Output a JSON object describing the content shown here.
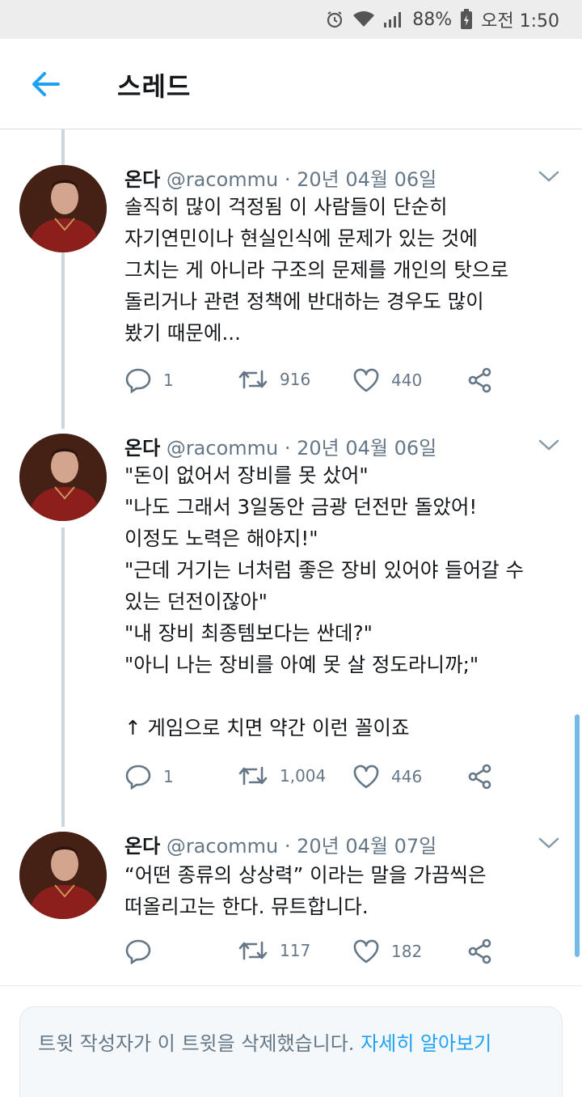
{
  "status_bar": {
    "battery": "88%",
    "time": "오전 1:50"
  },
  "header": {
    "title": "스레드"
  },
  "tweets": [
    {
      "name": "온다",
      "handle": "@racommu",
      "date": "· 20년 04월 06일",
      "lines": [
        "솔직히 많이 걱정됨 이 사람들이 단순히",
        "자기연민이나 현실인식에 문제가 있는 것에",
        "그치는 게 아니라 구조의 문제를 개인의 탓으로",
        "돌리거나 관련 정책에 반대하는 경우도 많이",
        "봤기 때문에..."
      ],
      "replies": "1",
      "retweets": "916",
      "likes": "440"
    },
    {
      "name": "온다",
      "handle": "@racommu",
      "date": "· 20년 04월 06일",
      "lines": [
        "\"돈이 없어서 장비를 못 샀어\"",
        "\"나도 그래서 3일동안 금광 던전만 돌았어!",
        "이정도 노력은 해야지!\"",
        "\"근데 거기는 너처럼 좋은 장비 있어야 들어갈 수",
        "있는 던전이잖아\"",
        "\"내 장비 최종템보다는 싼데?\"",
        "\"아니 나는 장비를 아예 못 살 정도라니까;\"",
        "",
        "↑ 게임으로 치면 약간 이런 꼴이죠"
      ],
      "replies": "1",
      "retweets": "1,004",
      "likes": "446"
    },
    {
      "name": "온다",
      "handle": "@racommu",
      "date": "· 20년 04월 07일",
      "lines": [
        "“어떤 종류의 상상력” 이라는 말을 가끔씩은",
        "떠올리고는 한다. 뮤트합니다."
      ],
      "replies": "",
      "retweets": "117",
      "likes": "182"
    }
  ],
  "notice": {
    "text": "트윗 작성자가 이 트윗을 삭제했습니다. ",
    "link": "자세히 알아보기"
  },
  "colors": {
    "accent": "#1da1f2",
    "secondary_text": "#657786",
    "action_icon": "#657786"
  },
  "icons": [
    "back-arrow-icon",
    "chevron-down-icon",
    "reply-icon",
    "retweet-icon",
    "like-icon",
    "share-icon",
    "alarm-icon",
    "wifi-icon",
    "signal-icon",
    "battery-icon"
  ]
}
